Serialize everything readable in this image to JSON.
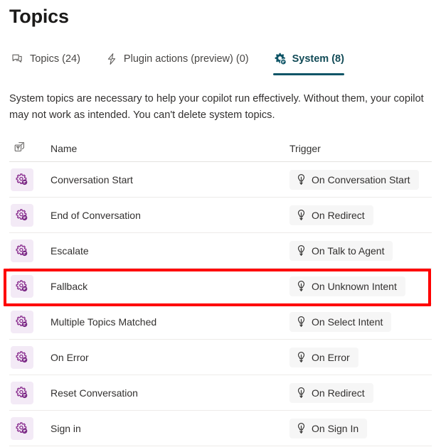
{
  "page": {
    "title": "Topics"
  },
  "tabs": [
    {
      "label": "Topics (24)",
      "icon": "chat-bubble-icon",
      "selected": false,
      "name": "tab-topics"
    },
    {
      "label": "Plugin actions (preview) (0)",
      "icon": "lightning-bolt-icon",
      "selected": false,
      "name": "tab-plugin-actions"
    },
    {
      "label": "System (8)",
      "icon": "gear-badge-icon",
      "selected": true,
      "name": "tab-system"
    }
  ],
  "description": "System topics are necessary to help your copilot run effectively. Without them, your copilot may not work as intended. You can't delete system topics.",
  "table": {
    "columns": {
      "icon": "cube-icon",
      "name": "Name",
      "trigger": "Trigger"
    },
    "rows": [
      {
        "icon": "topic-gear-icon",
        "name": "Conversation Start",
        "trigger": "On Conversation Start",
        "trigger_icon": "trigger-bolt-icon",
        "highlighted": false
      },
      {
        "icon": "topic-gear-icon",
        "name": "End of Conversation",
        "trigger": "On Redirect",
        "trigger_icon": "trigger-bolt-icon",
        "highlighted": false
      },
      {
        "icon": "topic-gear-icon",
        "name": "Escalate",
        "trigger": "On Talk to Agent",
        "trigger_icon": "trigger-bolt-icon",
        "highlighted": false
      },
      {
        "icon": "topic-gear-icon",
        "name": "Fallback",
        "trigger": "On Unknown Intent",
        "trigger_icon": "trigger-bolt-icon",
        "highlighted": true
      },
      {
        "icon": "topic-gear-icon",
        "name": "Multiple Topics Matched",
        "trigger": "On Select Intent",
        "trigger_icon": "trigger-bolt-icon",
        "highlighted": false
      },
      {
        "icon": "topic-gear-icon",
        "name": "On Error",
        "trigger": "On Error",
        "trigger_icon": "trigger-bolt-icon",
        "highlighted": false
      },
      {
        "icon": "topic-gear-icon",
        "name": "Reset Conversation",
        "trigger": "On Redirect",
        "trigger_icon": "trigger-bolt-icon",
        "highlighted": false
      },
      {
        "icon": "topic-gear-icon",
        "name": "Sign in",
        "trigger": "On Sign In",
        "trigger_icon": "trigger-bolt-icon",
        "highlighted": false
      }
    ]
  },
  "annotation": {
    "type": "highlight-rectangle",
    "target_row": "Fallback",
    "color": "#fe0000"
  },
  "colors": {
    "selected_tab": "#0f5567",
    "topic_icon": "#8a2e8f",
    "topic_icon_bg": "#f3eaf6",
    "trigger_pill_bg": "#f6f6f6",
    "annotation": "#fe0000",
    "text": "#32302f"
  }
}
